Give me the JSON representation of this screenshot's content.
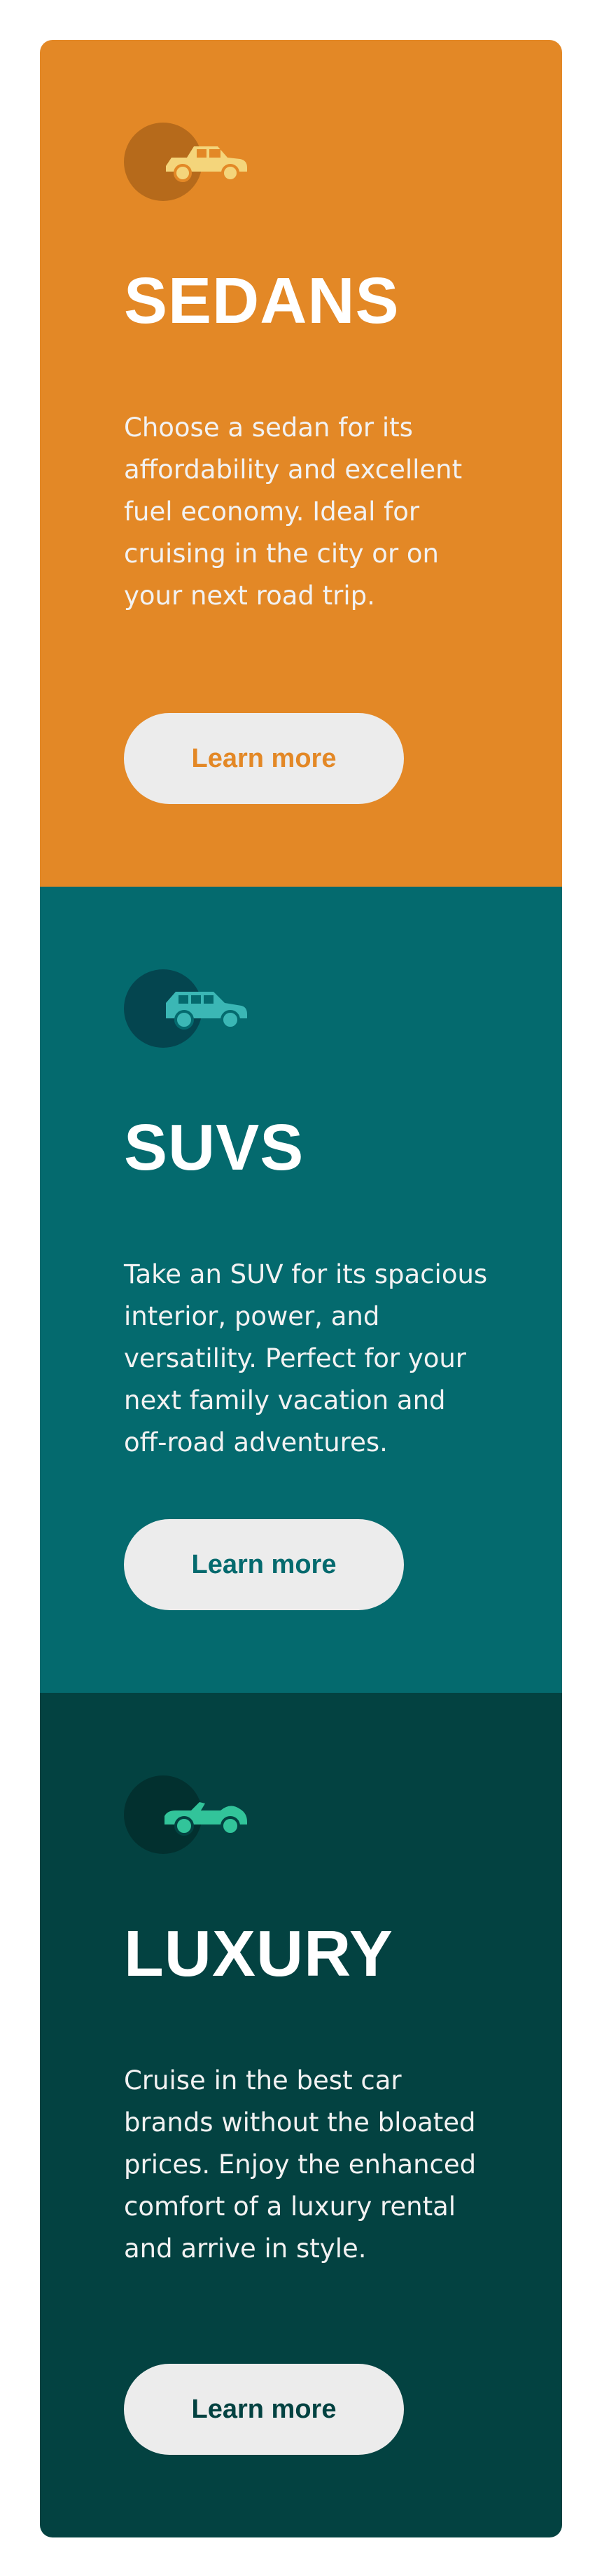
{
  "cards": [
    {
      "id": "sedans",
      "title": "SEDANS",
      "description": "Choose a sedan for its affordability and excellent fuel economy. Ideal for cruising in the city or on your next road trip.",
      "button_label": "Learn more",
      "icon": "sedan-car-icon",
      "colors": {
        "background": "#e38826",
        "icon_circle": "#b66a1b",
        "icon": "#f4d57b",
        "button_text": "#e38826"
      }
    },
    {
      "id": "suvs",
      "title": "SUVS",
      "description": "Take an SUV for its spacious interior, power, and versatility. Perfect for your next family vacation and off-road adventures.",
      "button_label": "Learn more",
      "icon": "suv-car-icon",
      "colors": {
        "background": "#046a6e",
        "icon_circle": "#04454f",
        "icon": "#3bb7b5",
        "button_text": "#046a6e"
      }
    },
    {
      "id": "luxury",
      "title": "LUXURY",
      "description": "Cruise in the best car brands without the bloated prices. Enjoy the enhanced comfort of a luxury rental and arrive in style.",
      "button_label": "Learn more",
      "icon": "convertible-car-icon",
      "colors": {
        "background": "#034241",
        "icon_circle": "#02302f",
        "icon": "#32c49a",
        "button_text": "#034241"
      }
    }
  ]
}
